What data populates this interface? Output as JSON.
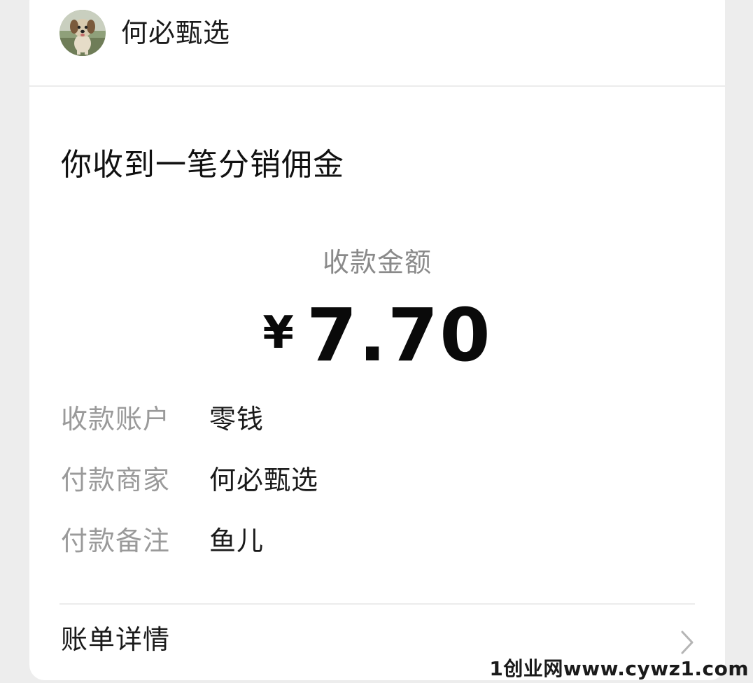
{
  "header": {
    "merchant_name": "何必甄选",
    "avatar_icon": "dog-avatar-icon"
  },
  "message": {
    "title": "你收到一笔分销佣金"
  },
  "amount": {
    "label": "收款金额",
    "currency": "¥",
    "value": "7.70"
  },
  "details": [
    {
      "label": "收款账户",
      "value": "零钱"
    },
    {
      "label": "付款商家",
      "value": "何必甄选"
    },
    {
      "label": "付款备注",
      "value": "鱼儿"
    }
  ],
  "footer": {
    "bill_details_label": "账单详情",
    "chevron_icon": "chevron-right-icon"
  },
  "watermark": "1创业网www.cywz1.com",
  "colors": {
    "background": "#ededed",
    "card": "#ffffff",
    "label_gray": "#9a9a9a",
    "text_dark": "#1a1a1a"
  }
}
